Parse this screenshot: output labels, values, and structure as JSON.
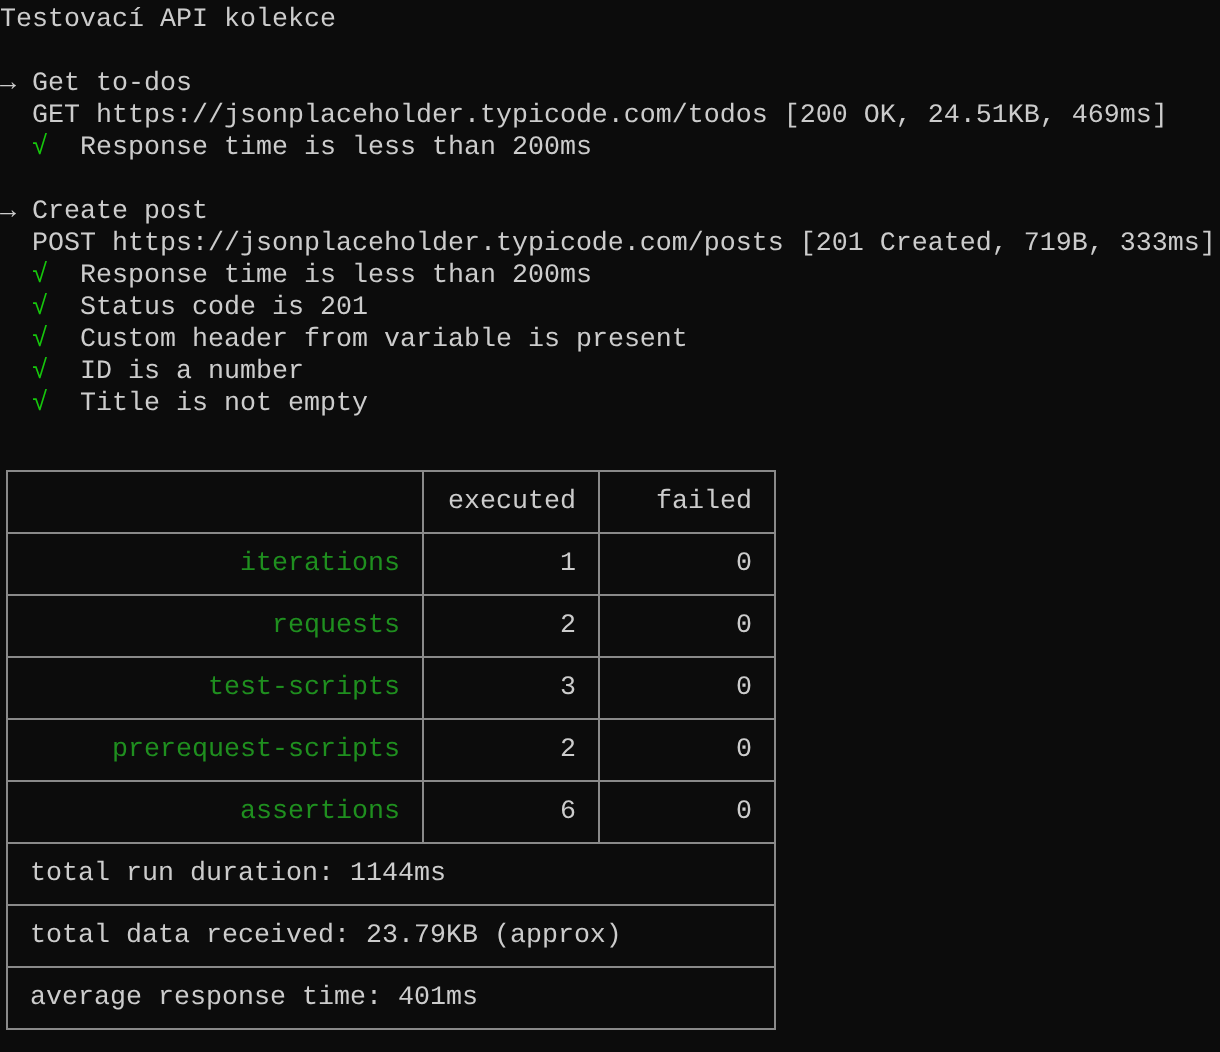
{
  "title": "Testovací API kolekce",
  "requests": [
    {
      "arrow": "→",
      "name": "Get to-dos",
      "request_line": "GET https://jsonplaceholder.typicode.com/todos [200 OK, 24.51KB, 469ms]",
      "assertions": [
        {
          "mark": "√",
          "text": "Response time is less than 200ms",
          "passed": true
        }
      ]
    },
    {
      "arrow": "→",
      "name": "Create post",
      "request_line": "POST https://jsonplaceholder.typicode.com/posts [201 Created, 719B, 333ms]",
      "assertions": [
        {
          "mark": "√",
          "text": "Response time is less than 200ms",
          "passed": true
        },
        {
          "mark": "√",
          "text": "Status code is 201",
          "passed": true
        },
        {
          "mark": "√",
          "text": "Custom header from variable is present",
          "passed": true
        },
        {
          "mark": "√",
          "text": "ID is a number",
          "passed": true
        },
        {
          "mark": "√",
          "text": "Title is not empty",
          "passed": true
        }
      ]
    }
  ],
  "summary_table": {
    "columns": [
      "executed",
      "failed"
    ],
    "rows": [
      {
        "label": "iterations",
        "executed": "1",
        "failed": "0"
      },
      {
        "label": "requests",
        "executed": "2",
        "failed": "0"
      },
      {
        "label": "test-scripts",
        "executed": "3",
        "failed": "0"
      },
      {
        "label": "prerequest-scripts",
        "executed": "2",
        "failed": "0"
      },
      {
        "label": "assertions",
        "executed": "6",
        "failed": "0"
      }
    ],
    "totals": [
      "total run duration: 1144ms",
      "total data received: 23.79KB (approx)",
      "average response time: 401ms"
    ]
  }
}
